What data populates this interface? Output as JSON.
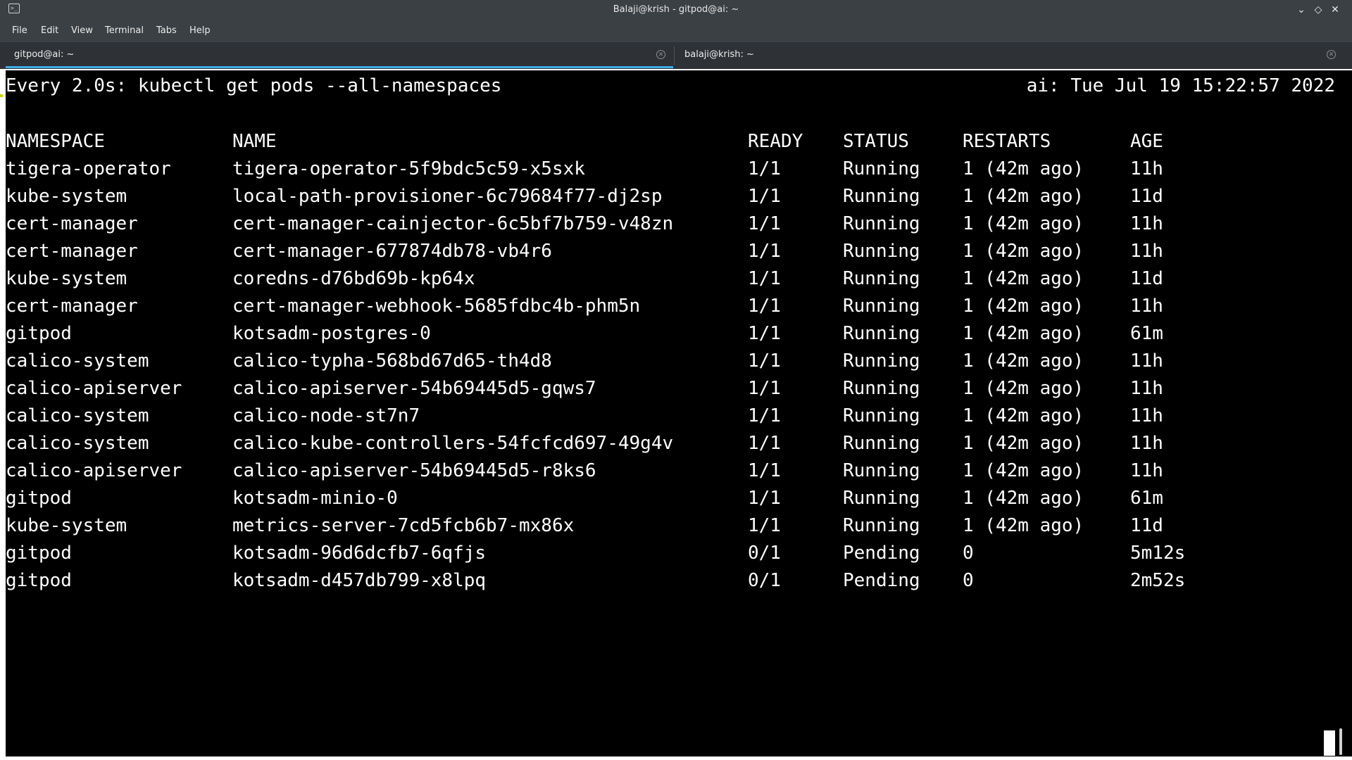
{
  "window": {
    "title": "Balaji@krish - gitpod@ai: ~",
    "controls": {
      "minimize_icon": "chevron-down-icon",
      "maximize_icon": "diamond-icon",
      "close_icon": "close-icon"
    }
  },
  "menu": {
    "items": [
      "File",
      "Edit",
      "View",
      "Terminal",
      "Tabs",
      "Help"
    ]
  },
  "tabs": [
    {
      "label": "gitpod@ai: ~",
      "active": true
    },
    {
      "label": "balaji@krish: ~",
      "active": false
    }
  ],
  "terminal": {
    "watch_command": "Every 2.0s: kubectl get pods --all-namespaces",
    "host_time": "ai: Tue Jul 19 15:22:57 2022",
    "headers": [
      "NAMESPACE",
      "NAME",
      "READY",
      "STATUS",
      "RESTARTS",
      "AGE"
    ],
    "rows": [
      [
        "tigera-operator",
        "tigera-operator-5f9bdc5c59-x5sxk",
        "1/1",
        "Running",
        "1 (42m ago)",
        "11h"
      ],
      [
        "kube-system",
        "local-path-provisioner-6c79684f77-dj2sp",
        "1/1",
        "Running",
        "1 (42m ago)",
        "11d"
      ],
      [
        "cert-manager",
        "cert-manager-cainjector-6c5bf7b759-v48zn",
        "1/1",
        "Running",
        "1 (42m ago)",
        "11h"
      ],
      [
        "cert-manager",
        "cert-manager-677874db78-vb4r6",
        "1/1",
        "Running",
        "1 (42m ago)",
        "11h"
      ],
      [
        "kube-system",
        "coredns-d76bd69b-kp64x",
        "1/1",
        "Running",
        "1 (42m ago)",
        "11d"
      ],
      [
        "cert-manager",
        "cert-manager-webhook-5685fdbc4b-phm5n",
        "1/1",
        "Running",
        "1 (42m ago)",
        "11h"
      ],
      [
        "gitpod",
        "kotsadm-postgres-0",
        "1/1",
        "Running",
        "1 (42m ago)",
        "61m"
      ],
      [
        "calico-system",
        "calico-typha-568bd67d65-th4d8",
        "1/1",
        "Running",
        "1 (42m ago)",
        "11h"
      ],
      [
        "calico-apiserver",
        "calico-apiserver-54b69445d5-gqws7",
        "1/1",
        "Running",
        "1 (42m ago)",
        "11h"
      ],
      [
        "calico-system",
        "calico-node-st7n7",
        "1/1",
        "Running",
        "1 (42m ago)",
        "11h"
      ],
      [
        "calico-system",
        "calico-kube-controllers-54fcfcd697-49g4v",
        "1/1",
        "Running",
        "1 (42m ago)",
        "11h"
      ],
      [
        "calico-apiserver",
        "calico-apiserver-54b69445d5-r8ks6",
        "1/1",
        "Running",
        "1 (42m ago)",
        "11h"
      ],
      [
        "gitpod",
        "kotsadm-minio-0",
        "1/1",
        "Running",
        "1 (42m ago)",
        "61m"
      ],
      [
        "kube-system",
        "metrics-server-7cd5fcb6b7-mx86x",
        "1/1",
        "Running",
        "1 (42m ago)",
        "11d"
      ],
      [
        "gitpod",
        "kotsadm-96d6dcfb7-6qfjs",
        "0/1",
        "Pending",
        "0",
        "5m12s"
      ],
      [
        "gitpod",
        "kotsadm-d457db799-x8lpq",
        "0/1",
        "Pending",
        "0",
        "2m52s"
      ]
    ]
  },
  "colors": {
    "chrome_bg": "#3b4045",
    "tab_active_accent": "#3daee9",
    "terminal_bg": "#000000",
    "terminal_fg": "#ffffff"
  }
}
